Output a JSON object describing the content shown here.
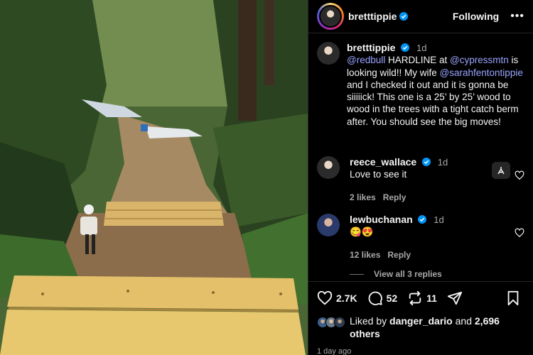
{
  "post": {
    "username": "bretttippie",
    "follow_state": "Following",
    "more_label": "•••"
  },
  "caption": {
    "username": "bretttippie",
    "time": "1d",
    "mention_1": "@redbull",
    "text_1": " HARDLINE at ",
    "mention_2": "@cypressmtn",
    "text_2": " is looking wild!! My wife ",
    "mention_3": "@sarahfentontippie",
    "text_3": " and I checked it out and it is gonna be siiiiick! This one is a 25’ by 25’ wood to wood in the trees with a tight catch berm after. You should see the big moves!"
  },
  "comments": [
    {
      "username": "reece_wallace",
      "time": "1d",
      "text": "Love to see it",
      "likes": "2 likes",
      "reply": "Reply"
    },
    {
      "username": "lewbuchanan",
      "time": "1d",
      "text": "😋😍",
      "likes": "12 likes",
      "reply": "Reply"
    }
  ],
  "view_replies": "View all 3 replies",
  "actions": {
    "likes_count": "2.7K",
    "comments_count": "52",
    "reposts_count": "11"
  },
  "liked_by": {
    "prefix": "Liked by ",
    "user": "danger_dario",
    "middle": " and ",
    "count": "2,696",
    "suffix": " others"
  },
  "posted_ago": "1 day ago",
  "icons": [
    "verified-icon",
    "more-icon",
    "translate-icon",
    "heart-icon",
    "comment-icon",
    "repost-icon",
    "share-icon",
    "save-icon"
  ],
  "colors": {
    "background": "#000000",
    "mention": "#9aa4ff",
    "verified": "#0095f6",
    "secondary_text": "#a8a8a8"
  }
}
